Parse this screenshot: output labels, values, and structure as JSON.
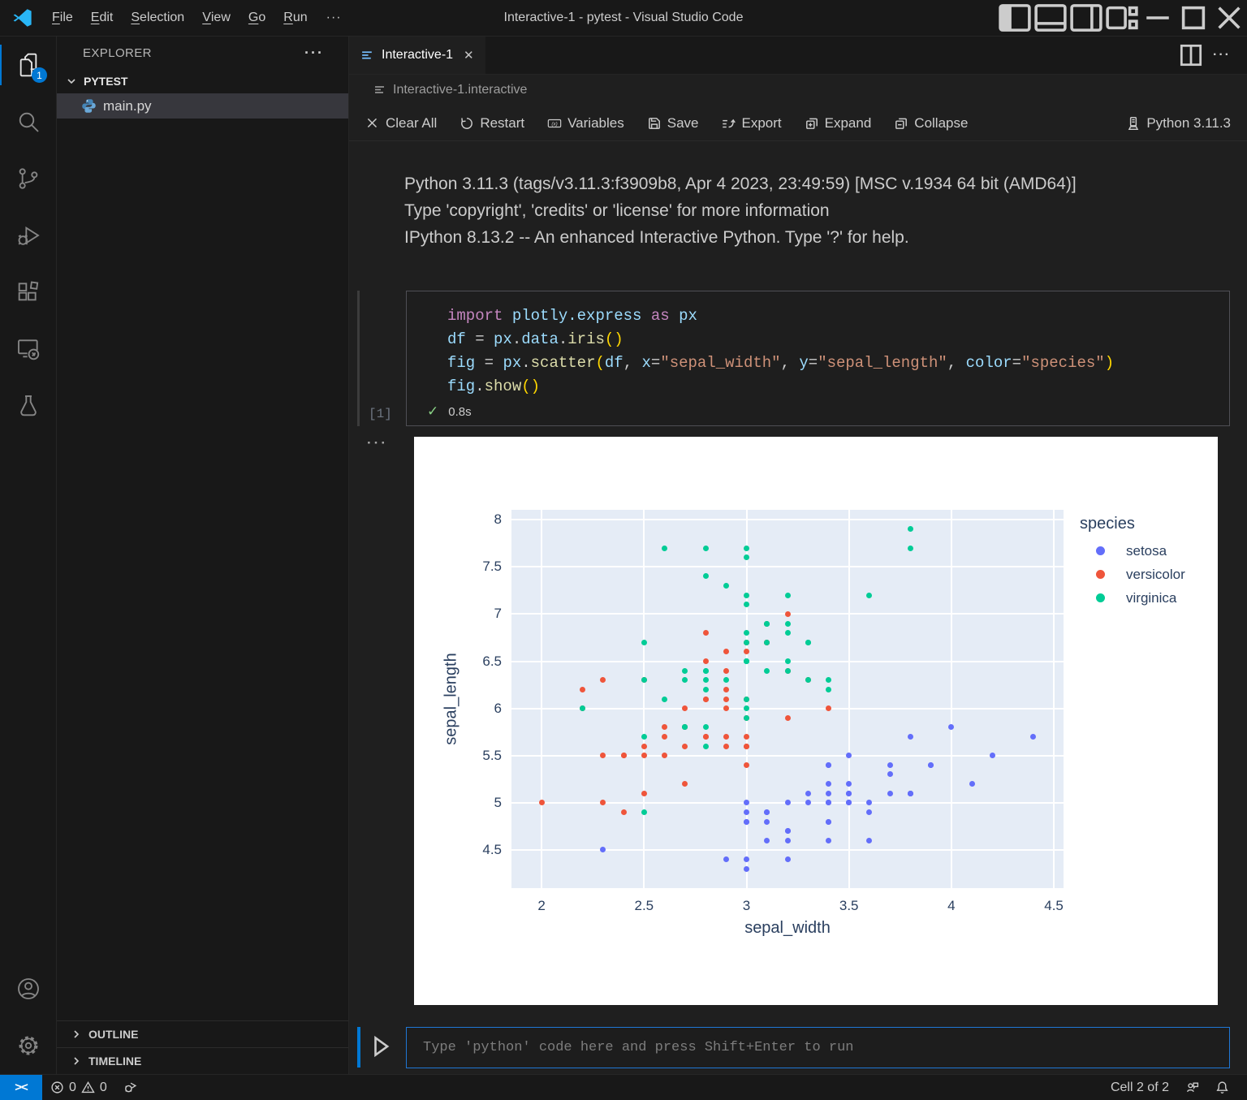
{
  "window": {
    "title": "Interactive-1 - pytest - Visual Studio Code"
  },
  "title_bar": {
    "menus": [
      "File",
      "Edit",
      "Selection",
      "View",
      "Go",
      "Run"
    ],
    "overflow_icon": "···"
  },
  "icons": {
    "close": "✕",
    "more": "···",
    "check": "✓",
    "remote": "><"
  },
  "activity_bar": {
    "badge": "1",
    "items": [
      "explorer",
      "search",
      "source-control",
      "run-and-debug",
      "extensions",
      "remote-explorer",
      "testing"
    ],
    "bottom_items": [
      "account",
      "settings"
    ]
  },
  "sidebar": {
    "header": "EXPLORER",
    "folder": "PYTEST",
    "file": "main.py",
    "outline": "OUTLINE",
    "timeline": "TIMELINE"
  },
  "editor": {
    "tab": {
      "label": "Interactive-1"
    },
    "breadcrumb": "Interactive-1.interactive",
    "toolbar": {
      "clear_all": "Clear All",
      "restart": "Restart",
      "variables": "Variables",
      "save": "Save",
      "export": "Export",
      "expand": "Expand",
      "collapse": "Collapse",
      "kernel": "Python 3.11.3"
    },
    "banner": [
      "Python 3.11.3 (tags/v3.11.3:f3909b8, Apr 4 2023, 23:49:59) [MSC v.1934 64 bit (AMD64)]",
      "Type 'copyright', 'credits' or 'license' for more information",
      "IPython 8.13.2 -- An enhanced Interactive Python. Type '?' for help."
    ],
    "cell": {
      "execution_count": "[1]",
      "status_icon": "✓",
      "duration": "0.8s",
      "code_lines": [
        [
          {
            "t": "import",
            "c": "kw"
          },
          {
            "t": " ",
            "c": "pl"
          },
          {
            "t": "plotly.express",
            "c": "var"
          },
          {
            "t": " ",
            "c": "pl"
          },
          {
            "t": "as",
            "c": "kw"
          },
          {
            "t": " ",
            "c": "pl"
          },
          {
            "t": "px",
            "c": "var"
          }
        ],
        [
          {
            "t": "df",
            "c": "var"
          },
          {
            "t": " = ",
            "c": "pl"
          },
          {
            "t": "px",
            "c": "var"
          },
          {
            "t": ".",
            "c": "pl"
          },
          {
            "t": "data",
            "c": "var"
          },
          {
            "t": ".",
            "c": "pl"
          },
          {
            "t": "iris",
            "c": "fn"
          },
          {
            "t": "()",
            "c": "br"
          }
        ],
        [
          {
            "t": "fig",
            "c": "var"
          },
          {
            "t": " = ",
            "c": "pl"
          },
          {
            "t": "px",
            "c": "var"
          },
          {
            "t": ".",
            "c": "pl"
          },
          {
            "t": "scatter",
            "c": "fn"
          },
          {
            "t": "(",
            "c": "br"
          },
          {
            "t": "df",
            "c": "var"
          },
          {
            "t": ", ",
            "c": "pl"
          },
          {
            "t": "x",
            "c": "var"
          },
          {
            "t": "=",
            "c": "pl"
          },
          {
            "t": "\"sepal_width\"",
            "c": "str"
          },
          {
            "t": ", ",
            "c": "pl"
          },
          {
            "t": "y",
            "c": "var"
          },
          {
            "t": "=",
            "c": "pl"
          },
          {
            "t": "\"sepal_length\"",
            "c": "str"
          },
          {
            "t": ", ",
            "c": "pl"
          },
          {
            "t": "color",
            "c": "var"
          },
          {
            "t": "=",
            "c": "pl"
          },
          {
            "t": "\"species\"",
            "c": "str"
          },
          {
            "t": ")",
            "c": "br"
          }
        ],
        [
          {
            "t": "fig",
            "c": "var"
          },
          {
            "t": ".",
            "c": "pl"
          },
          {
            "t": "show",
            "c": "fn"
          },
          {
            "t": "()",
            "c": "br"
          }
        ]
      ]
    },
    "input": {
      "placeholder": "Type 'python' code here and press Shift+Enter to run"
    }
  },
  "status_bar": {
    "errors": "0",
    "warnings": "0",
    "cell_indicator": "Cell 2 of 2"
  },
  "colors": {
    "accent": "#0078d4",
    "plot_background": "#E5ECF6",
    "setosa": "#636EFA",
    "versicolor": "#EF553B",
    "virginica": "#00CC96"
  },
  "chart_data": {
    "type": "scatter",
    "title": "",
    "xlabel": "sepal_width",
    "ylabel": "sepal_length",
    "legend_title": "species",
    "legend_position": "right",
    "grid": true,
    "x_range": [
      1.8528,
      4.5472
    ],
    "y_range": [
      4.0955,
      8.1045
    ],
    "x_ticks": [
      2,
      2.5,
      3,
      3.5,
      4,
      4.5
    ],
    "x_tick_labels": [
      "2",
      "2.5",
      "3",
      "3.5",
      "4",
      "4.5"
    ],
    "y_ticks": [
      4.5,
      5,
      5.5,
      6,
      6.5,
      7,
      7.5,
      8
    ],
    "y_tick_labels": [
      "4.5",
      "5",
      "5.5",
      "6",
      "6.5",
      "7",
      "7.5",
      "8"
    ],
    "series": [
      {
        "name": "setosa",
        "color": "#636EFA",
        "points": [
          [
            3.5,
            5.1
          ],
          [
            3.0,
            4.9
          ],
          [
            3.2,
            4.7
          ],
          [
            3.1,
            4.6
          ],
          [
            3.6,
            5.0
          ],
          [
            3.9,
            5.4
          ],
          [
            3.4,
            4.6
          ],
          [
            3.4,
            5.0
          ],
          [
            2.9,
            4.4
          ],
          [
            3.1,
            4.9
          ],
          [
            3.7,
            5.4
          ],
          [
            3.4,
            4.8
          ],
          [
            3.0,
            4.8
          ],
          [
            3.0,
            4.3
          ],
          [
            4.0,
            5.8
          ],
          [
            4.4,
            5.7
          ],
          [
            3.9,
            5.4
          ],
          [
            3.5,
            5.1
          ],
          [
            3.8,
            5.7
          ],
          [
            3.8,
            5.1
          ],
          [
            3.4,
            5.4
          ],
          [
            3.7,
            5.1
          ],
          [
            3.6,
            4.6
          ],
          [
            3.3,
            5.1
          ],
          [
            3.4,
            4.8
          ],
          [
            3.0,
            5.0
          ],
          [
            3.4,
            5.0
          ],
          [
            3.5,
            5.2
          ],
          [
            3.4,
            5.2
          ],
          [
            3.2,
            4.7
          ],
          [
            3.1,
            4.8
          ],
          [
            3.4,
            5.4
          ],
          [
            4.1,
            5.2
          ],
          [
            4.2,
            5.5
          ],
          [
            3.1,
            4.9
          ],
          [
            3.2,
            5.0
          ],
          [
            3.5,
            5.5
          ],
          [
            3.6,
            4.9
          ],
          [
            3.0,
            4.4
          ],
          [
            3.4,
            5.1
          ],
          [
            3.5,
            5.0
          ],
          [
            2.3,
            4.5
          ],
          [
            3.2,
            4.4
          ],
          [
            3.5,
            5.0
          ],
          [
            3.8,
            5.1
          ],
          [
            3.0,
            4.8
          ],
          [
            3.8,
            5.1
          ],
          [
            3.2,
            4.6
          ],
          [
            3.7,
            5.3
          ],
          [
            3.3,
            5.0
          ]
        ]
      },
      {
        "name": "versicolor",
        "color": "#EF553B",
        "points": [
          [
            3.2,
            7.0
          ],
          [
            3.2,
            6.4
          ],
          [
            3.1,
            6.9
          ],
          [
            2.3,
            5.5
          ],
          [
            2.8,
            6.5
          ],
          [
            2.8,
            5.7
          ],
          [
            3.3,
            6.3
          ],
          [
            2.4,
            4.9
          ],
          [
            2.9,
            6.6
          ],
          [
            2.7,
            5.2
          ],
          [
            2.0,
            5.0
          ],
          [
            3.0,
            5.9
          ],
          [
            2.2,
            6.0
          ],
          [
            2.9,
            6.1
          ],
          [
            2.9,
            5.6
          ],
          [
            3.1,
            6.7
          ],
          [
            3.0,
            5.6
          ],
          [
            2.7,
            5.8
          ],
          [
            2.2,
            6.2
          ],
          [
            2.5,
            5.6
          ],
          [
            3.2,
            5.9
          ],
          [
            2.8,
            6.1
          ],
          [
            2.5,
            6.3
          ],
          [
            2.8,
            6.1
          ],
          [
            2.9,
            6.4
          ],
          [
            3.0,
            6.6
          ],
          [
            2.8,
            6.8
          ],
          [
            3.0,
            6.7
          ],
          [
            2.9,
            6.0
          ],
          [
            2.6,
            5.7
          ],
          [
            2.4,
            5.5
          ],
          [
            2.4,
            5.5
          ],
          [
            2.7,
            5.8
          ],
          [
            2.7,
            6.0
          ],
          [
            3.0,
            5.4
          ],
          [
            3.4,
            6.0
          ],
          [
            3.1,
            6.7
          ],
          [
            2.3,
            6.3
          ],
          [
            3.0,
            5.6
          ],
          [
            2.5,
            5.5
          ],
          [
            2.6,
            5.5
          ],
          [
            3.0,
            6.1
          ],
          [
            2.6,
            5.8
          ],
          [
            2.3,
            5.0
          ],
          [
            2.7,
            5.6
          ],
          [
            3.0,
            5.7
          ],
          [
            2.9,
            5.7
          ],
          [
            2.9,
            6.2
          ],
          [
            2.5,
            5.1
          ],
          [
            2.8,
            5.7
          ]
        ]
      },
      {
        "name": "virginica",
        "color": "#00CC96",
        "points": [
          [
            3.3,
            6.3
          ],
          [
            2.7,
            5.8
          ],
          [
            3.0,
            7.1
          ],
          [
            2.9,
            6.3
          ],
          [
            3.0,
            6.5
          ],
          [
            3.0,
            7.6
          ],
          [
            2.5,
            4.9
          ],
          [
            2.9,
            7.3
          ],
          [
            2.5,
            6.7
          ],
          [
            3.6,
            7.2
          ],
          [
            3.2,
            6.5
          ],
          [
            2.7,
            6.4
          ],
          [
            3.0,
            6.8
          ],
          [
            2.5,
            5.7
          ],
          [
            2.8,
            5.8
          ],
          [
            3.2,
            6.4
          ],
          [
            3.0,
            6.5
          ],
          [
            3.8,
            7.7
          ],
          [
            2.6,
            7.7
          ],
          [
            2.2,
            6.0
          ],
          [
            3.2,
            6.9
          ],
          [
            2.8,
            5.6
          ],
          [
            2.8,
            7.7
          ],
          [
            2.7,
            6.3
          ],
          [
            3.3,
            6.7
          ],
          [
            3.2,
            7.2
          ],
          [
            2.8,
            6.2
          ],
          [
            3.0,
            6.1
          ],
          [
            2.8,
            6.4
          ],
          [
            3.0,
            7.2
          ],
          [
            2.8,
            7.4
          ],
          [
            3.8,
            7.9
          ],
          [
            2.8,
            6.4
          ],
          [
            2.8,
            6.3
          ],
          [
            2.6,
            6.1
          ],
          [
            3.0,
            7.7
          ],
          [
            3.4,
            6.3
          ],
          [
            3.1,
            6.4
          ],
          [
            3.0,
            6.0
          ],
          [
            3.1,
            6.9
          ],
          [
            3.1,
            6.7
          ],
          [
            3.1,
            6.9
          ],
          [
            2.7,
            5.8
          ],
          [
            3.2,
            6.8
          ],
          [
            3.3,
            6.7
          ],
          [
            3.0,
            6.7
          ],
          [
            2.5,
            6.3
          ],
          [
            3.0,
            6.5
          ],
          [
            3.4,
            6.2
          ],
          [
            3.0,
            5.9
          ]
        ]
      }
    ]
  }
}
